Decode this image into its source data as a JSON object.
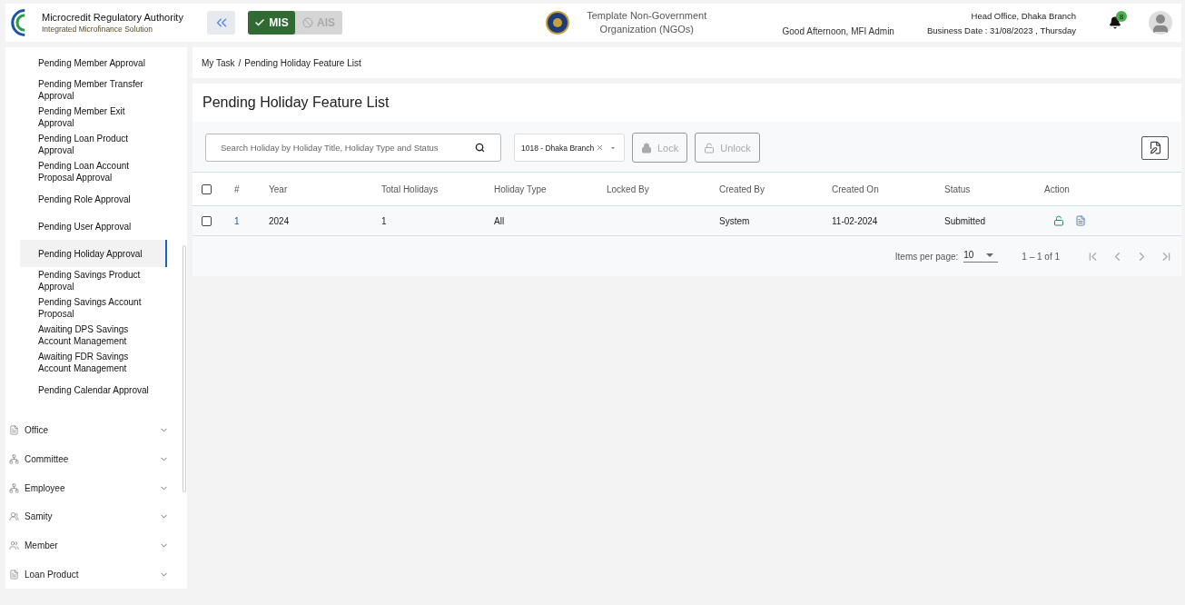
{
  "header": {
    "org_name": "Microcredit Regulatory Authority",
    "org_subtitle": "Integrated Microfinance Solution",
    "modules": [
      {
        "label": "MIS",
        "selected": true
      },
      {
        "label": "AIS",
        "selected": false
      }
    ],
    "organization": "Template Non-Government Organization (NGOs)",
    "greeting": "Good Afternoon, MFI Admin",
    "office": "Head Office, Dhaka Branch",
    "business_date": "Business Date : 31/08/2023 , Thursday",
    "notification_count": "8"
  },
  "sidebar": {
    "submenu": [
      {
        "label": "Pending Member Approval",
        "selected": false
      },
      {
        "label": "Pending Member Transfer Approval",
        "selected": false
      },
      {
        "label": "Pending Member Exit Approval",
        "selected": false
      },
      {
        "label": "Pending Loan Product Approval",
        "selected": false
      },
      {
        "label": "Pending Loan Account Proposal Approval",
        "selected": false
      },
      {
        "label": "Pending Role Approval",
        "selected": false
      },
      {
        "label": "Pending User Approval",
        "selected": false
      },
      {
        "label": "Pending Holiday Approval",
        "selected": true
      },
      {
        "label": "Pending Savings Product Approval",
        "selected": false
      },
      {
        "label": "Pending Savings Account Proposal",
        "selected": false
      },
      {
        "label": "Awaiting DPS Savings Account Management",
        "selected": false
      },
      {
        "label": "Awaiting FDR Savings Account Management",
        "selected": false
      },
      {
        "label": "Pending Calendar Approval",
        "selected": false
      }
    ],
    "menu": [
      {
        "label": "Office",
        "kind": "document",
        "expanded": false
      },
      {
        "label": "Committee",
        "kind": "org",
        "expanded": false
      },
      {
        "label": "Employee",
        "kind": "org",
        "expanded": false
      },
      {
        "label": "Samity",
        "kind": "group",
        "expanded": false
      },
      {
        "label": "Member",
        "kind": "people",
        "expanded": false
      },
      {
        "label": "Loan Product",
        "kind": "document",
        "expanded": false
      }
    ]
  },
  "breadcrumb": [
    "My Task",
    "Pending Holiday Feature List"
  ],
  "breadcrumb_separator": "/",
  "page_title": "Pending Holiday Feature List",
  "search": {
    "placeholder": "Search Holiday by Holiday Title, Holiday Type and Status"
  },
  "branch_select": {
    "value": "1018 - Dhaka Branch"
  },
  "buttons": [
    {
      "label": "Lock",
      "kind": "lock",
      "disabled": true
    },
    {
      "label": "Unlock",
      "kind": "unlock",
      "disabled": true
    }
  ],
  "table": {
    "columns": [
      "#",
      "Year",
      "Total Holidays",
      "Holiday Type",
      "Locked By",
      "Created By",
      "Created On",
      "Status",
      "Action"
    ],
    "header_checked": false,
    "rows": [
      {
        "checked": false,
        "cells": [
          "1",
          "2024",
          "1",
          "All",
          "",
          "System",
          "11-02-2024",
          "Submitted"
        ]
      }
    ]
  },
  "pagination": {
    "label": "Items per page:",
    "page_size": "10",
    "range": "1 – 1 of 1"
  }
}
